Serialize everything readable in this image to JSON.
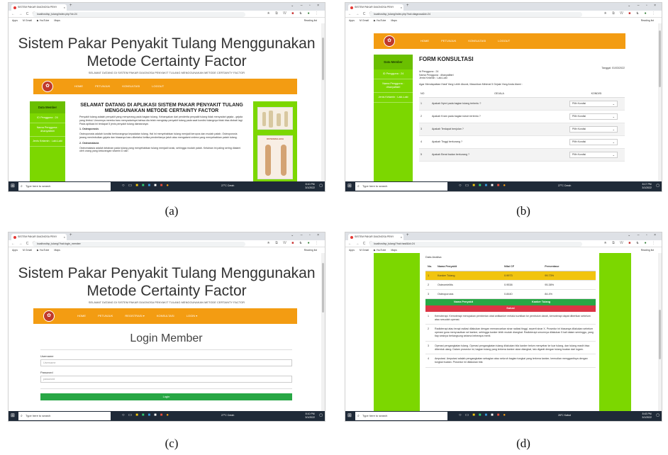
{
  "captions": [
    "(a)",
    "(b)",
    "(c)",
    "(d)"
  ],
  "browser": {
    "tab_title": "SISTEM PAKAR DIAGNOSA PENY",
    "tab_close": "×",
    "new_tab": "+",
    "window_controls": "⌄ – ▫ ×",
    "nav_icons": "← → C ⓘ",
    "bookmarks": [
      "Apps",
      "M Gmail",
      "▶ YouTube",
      "Maps"
    ],
    "reading_list": "Reading list"
  },
  "taskbar": {
    "search_placeholder": "Type here to search",
    "weather_a": "27°C Cerah",
    "weather_d": "26°C Kabut",
    "time_a": "8:10 PM",
    "time_b": "8:17 PM",
    "time_c": "8:10 PM",
    "time_d": "8:43 PM",
    "date": "3/1/2022"
  },
  "site": {
    "title_line1": "Sistem Pakar Penyakit Tulang Menggunakan",
    "title_line2": "Metode Certainty Factor",
    "subtitle": "SELAMAT DATANG DI SISTEM PAKAR DIAGNOSA PENYAKIT TULANG MENGGUNAKAN METODE CERTAINTY FACTOR",
    "logo_glyph": "✿"
  },
  "panel_a": {
    "url": "localhost/sp_tulang/index.php?id=24",
    "nav": [
      "HOME",
      "PETUNJUK",
      "KONSULTASI",
      "LOGOUT"
    ],
    "sidebar": {
      "heading": "Data Member",
      "items": [
        "ID Pengguna : 24",
        "Nama Pengguna : dhanyalfatri",
        "Jenis Kelamin : Laki-Laki"
      ]
    },
    "heading": "SELAMAT DATANG DI APLIKASI SISTEM PAKAR PENYAKIT TULANG MENGGUNAKAN METODE CERTAINTY FACTOR",
    "intro": "Penyakit tulang adalah penyakit yang menyerang pada bagian tulang. Kebanyakan dari penderita penyakit tulang tidak menyadari gejala - gejala yang timbul. Umumnya mereka baru menyadarinya bahwa dia telah mengidap penyakit tulang pada saat kondisi tulangnya tidak bisa diobati lagi. Pada aplikasi ini terdapat 5 jenis penyakit tulang diantaranya:",
    "section1": "1. Osteoporosis",
    "section1_text": "Osteoporosis adalah kondisi berkurangnya kepadatan tulang. Hal ini menyebabkan tulang menjadi keropos dan mudah patah. Osteoporosis jarang menimbulkan gejala dan biasanya baru diketahui ketika penderitanya jatuh atau mengalami cedera yang menyebabkan patah tulang.",
    "section2": "2. Osteomalacia",
    "section2_text": "Osteomalasia adalah kelainan pada tulang yang menyebabkan tulang menjadi lunak, sehingga mudah patah. Kelainan ini paling sering dialami oleh orang yang kekurangan vitamin D dan",
    "image_label": "OSTEOMALACIA"
  },
  "panel_b": {
    "url": "localhost/sp_tulang/index.php?hal=diagnosa&id=24",
    "nav": [
      "HOME",
      "PETUNJUK",
      "KONSULTASI",
      "LOGOUT"
    ],
    "sidebar": {
      "heading": "Data Member",
      "items": [
        "ID Pengguna : 24",
        "Nama Pengguna : dhanyalfatri",
        "Jenis Kelamin : Laki-Laki"
      ]
    },
    "form_title": "FORM KONSULTASI",
    "date": "Tanggal: 01/03/2022",
    "info": [
      "Id Pengguna : 24",
      "Nama Pengguna : dhanyalfatri",
      "Jenis Kelamin : Laki-Laki"
    ],
    "instruction": "Agar Mendapatkan Hasil Yang Lebih Akurat, Masukkan Minimal 5 Gejala Yang Anda Alami :",
    "columns": [
      "NO",
      "GEJALA",
      "KONDISI"
    ],
    "rows": [
      {
        "no": "1",
        "gejala": "Apakah Nyeri pada bagian tulang tertentu ?",
        "kondisi": "Pilih Kondisi"
      },
      {
        "no": "2",
        "gejala": "Apakah Kram pada bagian tubuh tertentu ?",
        "kondisi": "Pilih Kondisi"
      },
      {
        "no": "3",
        "gejala": "Apakah Terdapat benjolan ?",
        "kondisi": "Pilih Kondisi"
      },
      {
        "no": "4",
        "gejala": "Apakah Tinggi berkurang ?",
        "kondisi": "Pilih Kondisi"
      },
      {
        "no": "5",
        "gejala": "Apakah Berat badan berkurang ?",
        "kondisi": "Pilih Kondisi"
      }
    ]
  },
  "panel_c": {
    "url": "localhost/sp_tulang/?hal=login_member",
    "nav": [
      "HOME",
      "PETUNJUK",
      "REGISTRASI ▾",
      "KONSULTASI",
      "LOGIN ▾"
    ],
    "login_title": "Login Member",
    "username_label": "Username",
    "username_placeholder": "Username",
    "password_label": "Password",
    "password_placeholder": "password",
    "login_button": "Login"
  },
  "panel_d": {
    "url": "localhost/sp_tulang/?hal=hasil&id=24",
    "section_title": "Data Analisa",
    "columns": [
      "No.",
      "Nama Penyakit",
      "Nilai CF",
      "Persentase"
    ],
    "rows": [
      {
        "no": "1",
        "name": "Kanker Tulang",
        "cf": "0.9973",
        "pct": "99.73%"
      },
      {
        "no": "2",
        "name": "Osteomielitis",
        "cf": "0.9538",
        "pct": "95.38%"
      },
      {
        "no": "3",
        "name": "Osteoporosis",
        "cf": "0.8440",
        "pct": "84.4%"
      }
    ],
    "result_label": "Nama Penyakit",
    "result_value": "Kanker Tulang",
    "solusi_label": "Solusi",
    "solutions": [
      {
        "no": "1",
        "text": "Kemoterapi. Kemoterapi merupakan pemberian obat antikanker melalui suntikan ke pembuluh darah, kemoterapi dapat diberikan sebelum atau sesudah operasi."
      },
      {
        "no": "2",
        "text": "Radioterapi atau terapi radiasi dilakukan dengan memancarkan sinar radiasi tinggi, seperti sinar X. Prosedur ini biasanya dilakukan sebelum operasi guna menyusutkan sel kanker, sehingga kanker lebih mudah diangkat. Radioterapi umumnya dilakukan 5 kali dalam seminggu, yang tiap sesinya berlangsung selama beberapa menit."
      },
      {
        "no": "3",
        "text": "Operasi pengangkatan tulang. Operasi pengangkatan tulang dilakukan bila kanker belum menyebar ke luar tulang, dan tulang masih bisa dibentuk ulang. Dalam prosedur ini, bagian tulang yang terkena kanker akan diangkat, lalu diganti dengan tulang buatan dari logam."
      },
      {
        "no": "4",
        "text": "Amputasi. Amputasi adalah pengangkatan sebagian atau seluruh bagian tungkai yang terkena kanker, kemudian menggantinya dengan tungkai buatan. Prosedur ini dilakukan bila"
      }
    ]
  }
}
